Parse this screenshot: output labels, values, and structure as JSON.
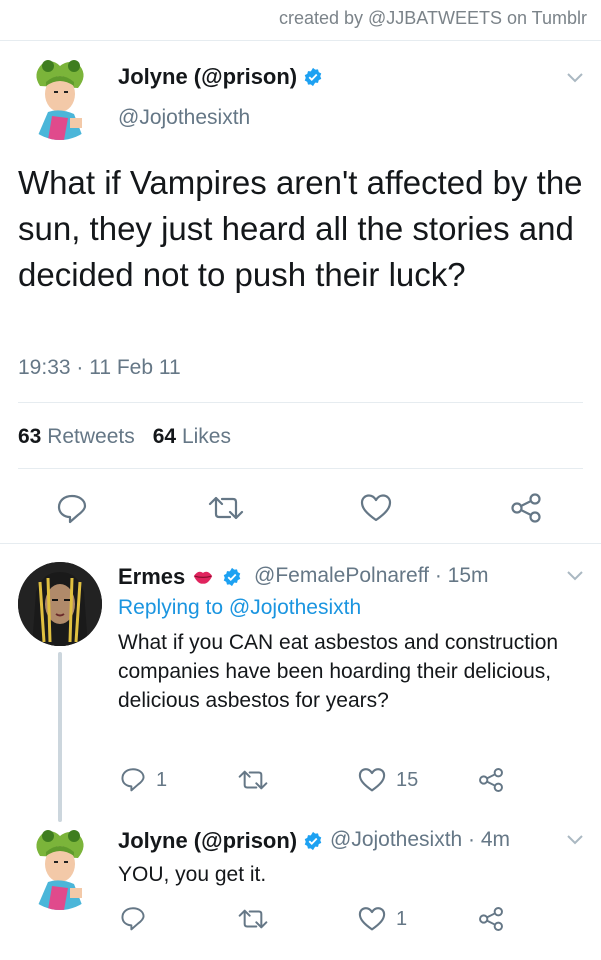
{
  "credit": "created by @JJBATWEETS on Tumblr",
  "main_tweet": {
    "name": "Jolyne (@prison)",
    "handle": "@Jojothesixth",
    "text": "What if Vampires aren't affected by the sun, they just heard all the stories and decided not to push their luck?",
    "timestamp": "19:33 · 11 Feb 11",
    "retweets_count": "63",
    "retweets_label": "Retweets",
    "likes_count": "64",
    "likes_label": "Likes"
  },
  "reply_1": {
    "name": "Ermes",
    "handle_time": "@FemalePolnareff · 15m",
    "replying_prefix": "Replying to",
    "replying_handle": "@Jojothesixth",
    "text": "What if you CAN eat asbestos and construction companies have been hoarding their delicious, delicious asbestos for years?",
    "reply_count": "1",
    "like_count": "15"
  },
  "reply_2": {
    "name": "Jolyne (@prison)",
    "handle_time": "@Jojothesixth · 4m",
    "text": "YOU, you get it.",
    "like_count": "1"
  },
  "colors": {
    "link": "#1b95e0",
    "secondary": "#657786",
    "verified": "#1da1f2",
    "lips": "#e0245e"
  }
}
